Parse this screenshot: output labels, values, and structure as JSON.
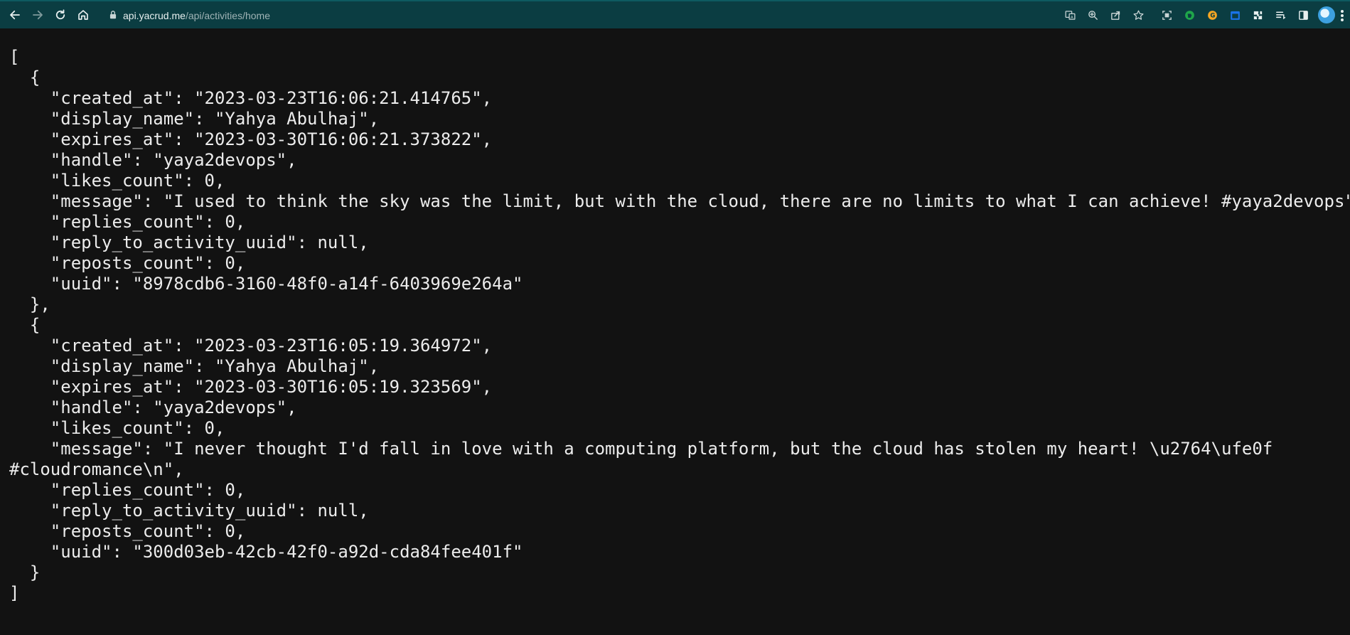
{
  "browser": {
    "url_host": "api.yacrud.me",
    "url_path": "/api/activities/home",
    "toolbar_icons": [
      "back-arrow-icon",
      "forward-arrow-icon",
      "reload-icon",
      "home-icon",
      "lock-icon",
      "translate-icon",
      "zoom-icon",
      "share-icon",
      "star-icon",
      "screenshot-icon",
      "evernote-icon",
      "grammarly-icon",
      "calendar-extension-icon",
      "extensions-puzzle-icon",
      "reading-list-icon",
      "side-panel-icon",
      "profile-avatar",
      "kebab-menu-icon"
    ],
    "colors": {
      "toolbar": "#0b3d42",
      "page_background": "#121212",
      "text": "#ececec"
    }
  },
  "json_lines": [
    "[",
    "  {",
    "    \"created_at\": \"2023-03-23T16:06:21.414765\",",
    "    \"display_name\": \"Yahya Abulhaj\",",
    "    \"expires_at\": \"2023-03-30T16:06:21.373822\",",
    "    \"handle\": \"yaya2devops\",",
    "    \"likes_count\": 0,",
    "    \"message\": \"I used to think the sky was the limit, but with the cloud, there are no limits to what I can achieve! #yaya2devops\",",
    "    \"replies_count\": 0,",
    "    \"reply_to_activity_uuid\": null,",
    "    \"reposts_count\": 0,",
    "    \"uuid\": \"8978cdb6-3160-48f0-a14f-6403969e264a\"",
    "  },",
    "  {",
    "    \"created_at\": \"2023-03-23T16:05:19.364972\",",
    "    \"display_name\": \"Yahya Abulhaj\",",
    "    \"expires_at\": \"2023-03-30T16:05:19.323569\",",
    "    \"handle\": \"yaya2devops\",",
    "    \"likes_count\": 0,",
    "    \"message\": \"I never thought I'd fall in love with a computing platform, but the cloud has stolen my heart! \\u2764\\ufe0f",
    "#cloudromance\\n\",",
    "    \"replies_count\": 0,",
    "    \"reply_to_activity_uuid\": null,",
    "    \"reposts_count\": 0,",
    "    \"uuid\": \"300d03eb-42cb-42f0-a92d-cda84fee401f\"",
    "  }",
    "]"
  ]
}
